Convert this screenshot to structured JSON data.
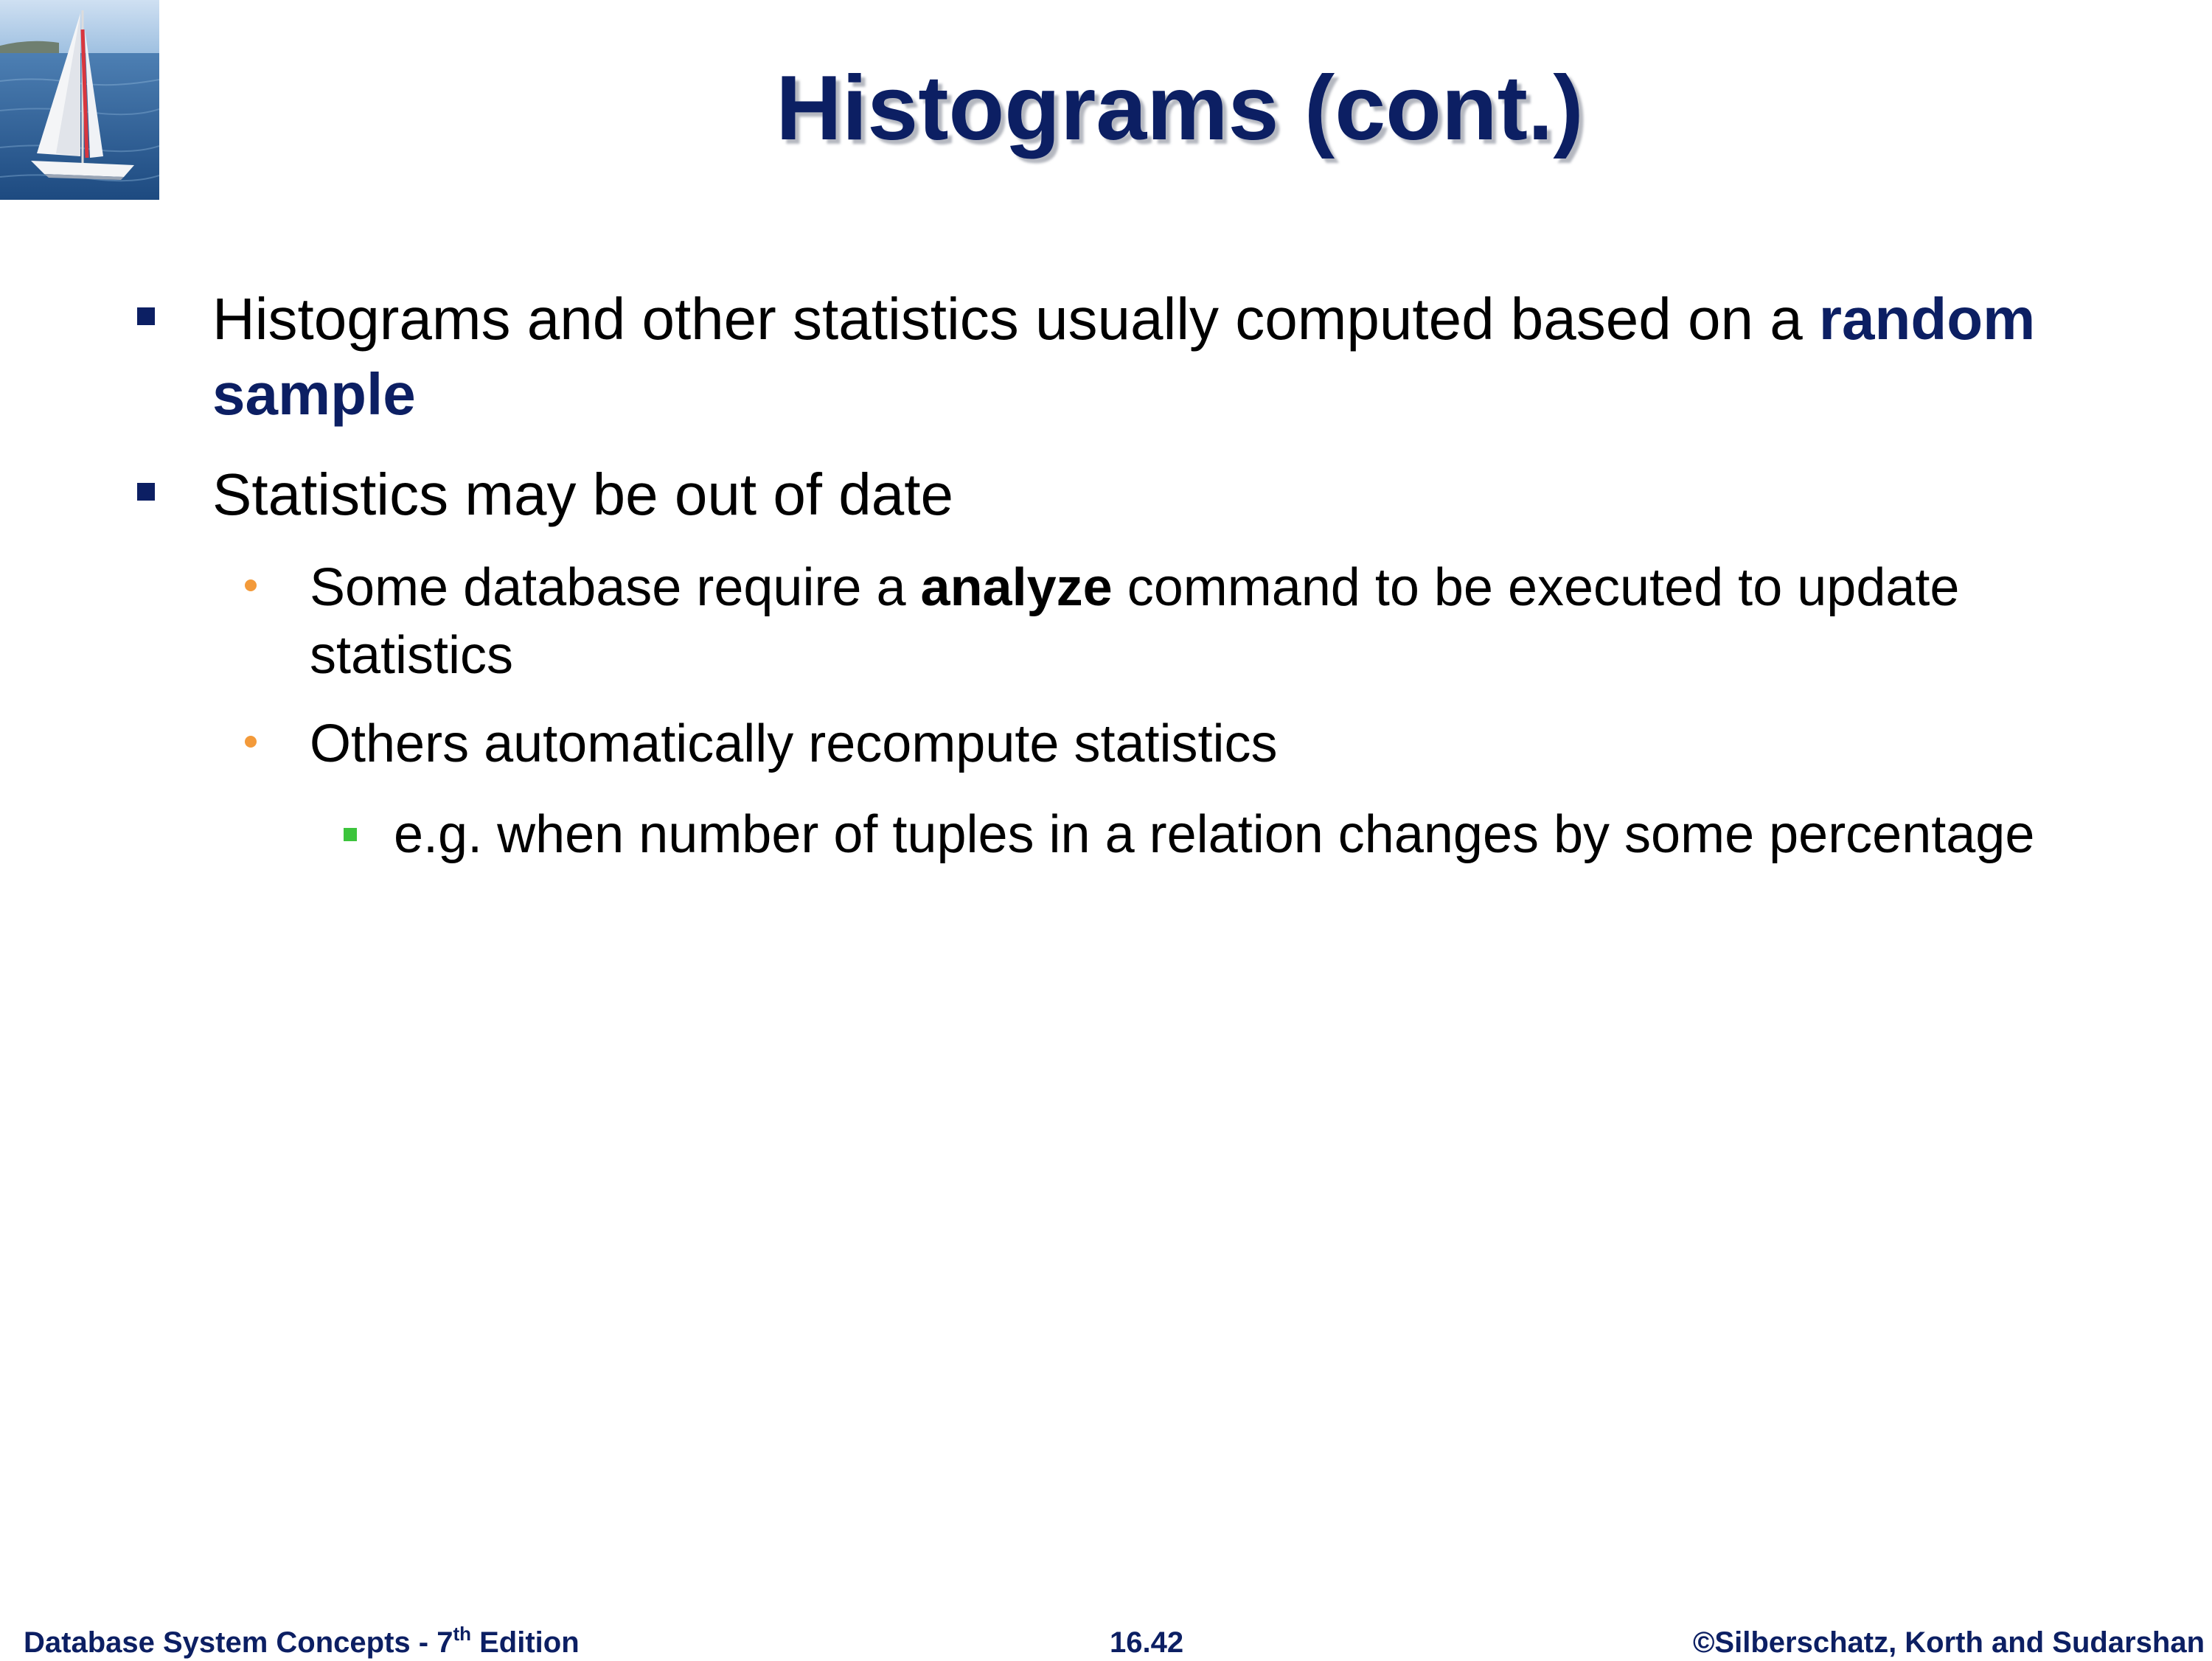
{
  "slide": {
    "title": "Histograms (cont.)",
    "bullets": [
      {
        "text_before": "Histograms and other statistics usually computed based on a ",
        "emphasis": "random sample"
      },
      {
        "text": "Statistics may be out of date",
        "sub": [
          {
            "text_before": "Some database require a ",
            "emphasis": "analyze",
            "text_after": "  command to be executed to update statistics"
          },
          {
            "text": "Others automatically recompute statistics",
            "sub": [
              {
                "text": "e.g. when number of tuples in a relation changes by some percentage"
              }
            ]
          }
        ]
      }
    ]
  },
  "footer": {
    "left_prefix": "Database System Concepts - 7",
    "left_sup": "th",
    "left_suffix": " Edition",
    "center": "16.42",
    "right": "©Silberschatz, Korth and Sudarshan"
  },
  "colors": {
    "title": "#0c1f63",
    "level1_bullet": "#0c1f63",
    "level2_bullet": "#f39a3a",
    "level3_bullet": "#3cc43c",
    "footer_text": "#0c1f63"
  },
  "icons": {
    "logo": "sailboat-logo-icon"
  }
}
